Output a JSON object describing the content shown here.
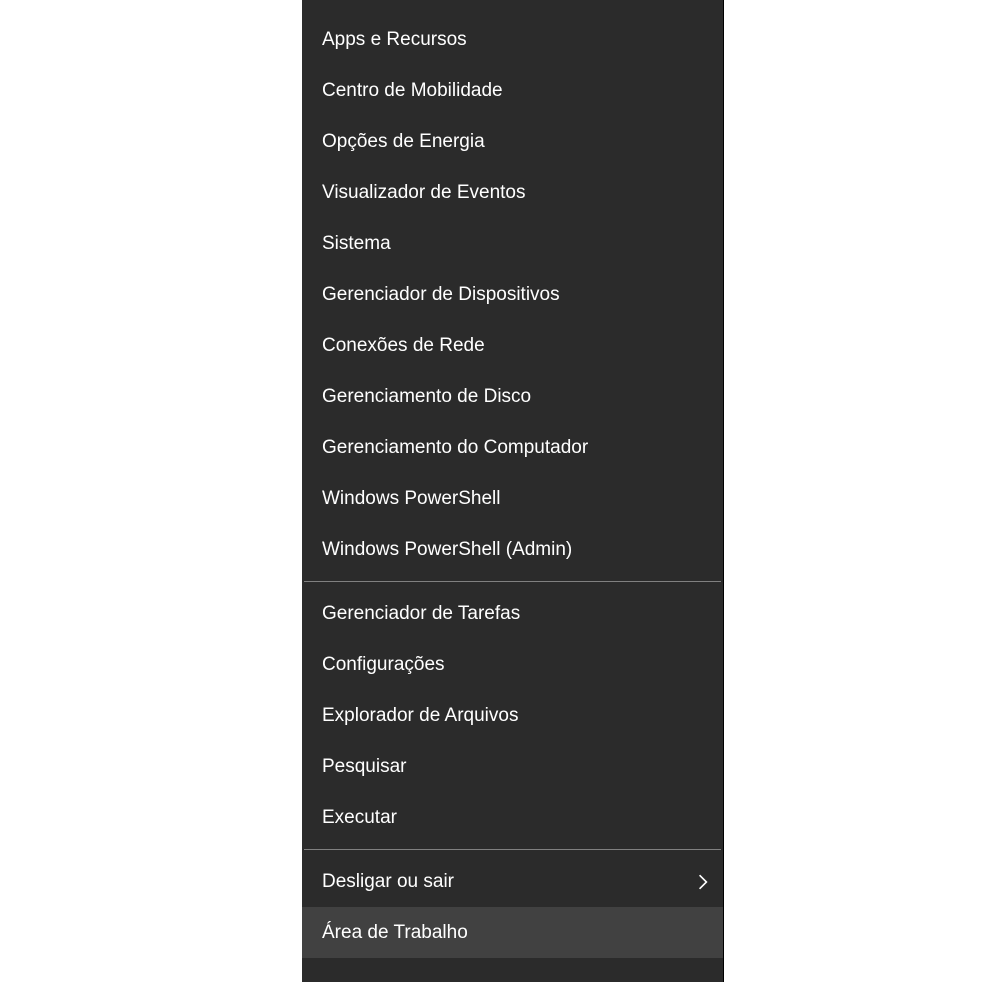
{
  "menu": {
    "groups": [
      {
        "items": [
          {
            "id": "apps-features",
            "label": "Apps e Recursos",
            "submenu": false
          },
          {
            "id": "mobility-center",
            "label": "Centro de Mobilidade",
            "submenu": false
          },
          {
            "id": "power-options",
            "label": "Opções de Energia",
            "submenu": false
          },
          {
            "id": "event-viewer",
            "label": "Visualizador de Eventos",
            "submenu": false
          },
          {
            "id": "system",
            "label": "Sistema",
            "submenu": false
          },
          {
            "id": "device-manager",
            "label": "Gerenciador de Dispositivos",
            "submenu": false
          },
          {
            "id": "network-connections",
            "label": "Conexões de Rede",
            "submenu": false
          },
          {
            "id": "disk-management",
            "label": "Gerenciamento de Disco",
            "submenu": false
          },
          {
            "id": "computer-management",
            "label": "Gerenciamento do Computador",
            "submenu": false
          },
          {
            "id": "powershell",
            "label": "Windows PowerShell",
            "submenu": false
          },
          {
            "id": "powershell-admin",
            "label": "Windows PowerShell (Admin)",
            "submenu": false
          }
        ]
      },
      {
        "items": [
          {
            "id": "task-manager",
            "label": "Gerenciador de Tarefas",
            "submenu": false
          },
          {
            "id": "settings",
            "label": "Configurações",
            "submenu": false
          },
          {
            "id": "file-explorer",
            "label": "Explorador de Arquivos",
            "submenu": false
          },
          {
            "id": "search",
            "label": "Pesquisar",
            "submenu": false
          },
          {
            "id": "run",
            "label": "Executar",
            "submenu": false
          }
        ]
      },
      {
        "items": [
          {
            "id": "shutdown-signout",
            "label": "Desligar ou sair",
            "submenu": true
          },
          {
            "id": "desktop",
            "label": "Área de Trabalho",
            "submenu": false,
            "hover": true
          }
        ]
      }
    ]
  }
}
